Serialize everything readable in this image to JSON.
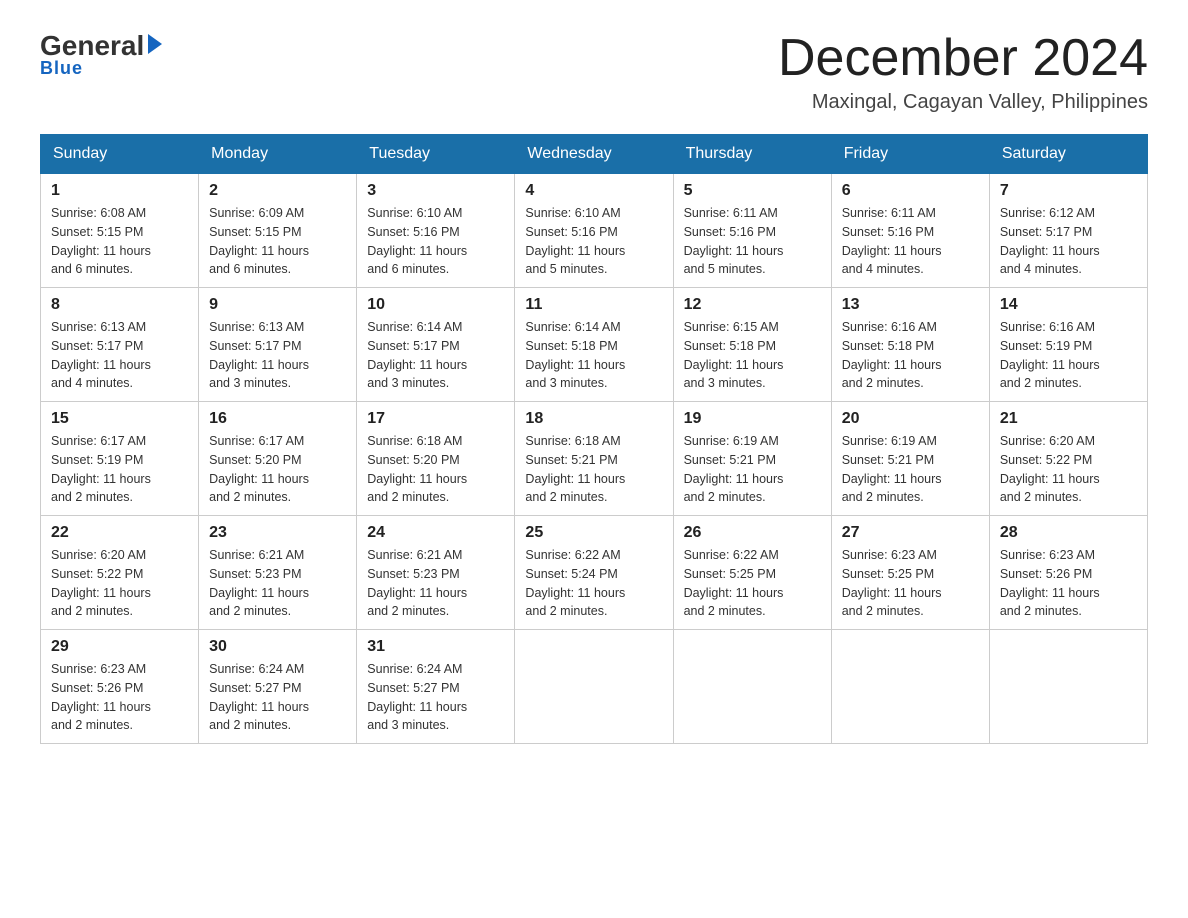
{
  "logo": {
    "general": "General",
    "arrow": "▶",
    "blue": "Blue"
  },
  "header": {
    "month_title": "December 2024",
    "location": "Maxingal, Cagayan Valley, Philippines"
  },
  "days_of_week": [
    "Sunday",
    "Monday",
    "Tuesday",
    "Wednesday",
    "Thursday",
    "Friday",
    "Saturday"
  ],
  "weeks": [
    [
      {
        "day": "1",
        "sunrise": "6:08 AM",
        "sunset": "5:15 PM",
        "daylight": "11 hours and 6 minutes."
      },
      {
        "day": "2",
        "sunrise": "6:09 AM",
        "sunset": "5:15 PM",
        "daylight": "11 hours and 6 minutes."
      },
      {
        "day": "3",
        "sunrise": "6:10 AM",
        "sunset": "5:16 PM",
        "daylight": "11 hours and 6 minutes."
      },
      {
        "day": "4",
        "sunrise": "6:10 AM",
        "sunset": "5:16 PM",
        "daylight": "11 hours and 5 minutes."
      },
      {
        "day": "5",
        "sunrise": "6:11 AM",
        "sunset": "5:16 PM",
        "daylight": "11 hours and 5 minutes."
      },
      {
        "day": "6",
        "sunrise": "6:11 AM",
        "sunset": "5:16 PM",
        "daylight": "11 hours and 4 minutes."
      },
      {
        "day": "7",
        "sunrise": "6:12 AM",
        "sunset": "5:17 PM",
        "daylight": "11 hours and 4 minutes."
      }
    ],
    [
      {
        "day": "8",
        "sunrise": "6:13 AM",
        "sunset": "5:17 PM",
        "daylight": "11 hours and 4 minutes."
      },
      {
        "day": "9",
        "sunrise": "6:13 AM",
        "sunset": "5:17 PM",
        "daylight": "11 hours and 3 minutes."
      },
      {
        "day": "10",
        "sunrise": "6:14 AM",
        "sunset": "5:17 PM",
        "daylight": "11 hours and 3 minutes."
      },
      {
        "day": "11",
        "sunrise": "6:14 AM",
        "sunset": "5:18 PM",
        "daylight": "11 hours and 3 minutes."
      },
      {
        "day": "12",
        "sunrise": "6:15 AM",
        "sunset": "5:18 PM",
        "daylight": "11 hours and 3 minutes."
      },
      {
        "day": "13",
        "sunrise": "6:16 AM",
        "sunset": "5:18 PM",
        "daylight": "11 hours and 2 minutes."
      },
      {
        "day": "14",
        "sunrise": "6:16 AM",
        "sunset": "5:19 PM",
        "daylight": "11 hours and 2 minutes."
      }
    ],
    [
      {
        "day": "15",
        "sunrise": "6:17 AM",
        "sunset": "5:19 PM",
        "daylight": "11 hours and 2 minutes."
      },
      {
        "day": "16",
        "sunrise": "6:17 AM",
        "sunset": "5:20 PM",
        "daylight": "11 hours and 2 minutes."
      },
      {
        "day": "17",
        "sunrise": "6:18 AM",
        "sunset": "5:20 PM",
        "daylight": "11 hours and 2 minutes."
      },
      {
        "day": "18",
        "sunrise": "6:18 AM",
        "sunset": "5:21 PM",
        "daylight": "11 hours and 2 minutes."
      },
      {
        "day": "19",
        "sunrise": "6:19 AM",
        "sunset": "5:21 PM",
        "daylight": "11 hours and 2 minutes."
      },
      {
        "day": "20",
        "sunrise": "6:19 AM",
        "sunset": "5:21 PM",
        "daylight": "11 hours and 2 minutes."
      },
      {
        "day": "21",
        "sunrise": "6:20 AM",
        "sunset": "5:22 PM",
        "daylight": "11 hours and 2 minutes."
      }
    ],
    [
      {
        "day": "22",
        "sunrise": "6:20 AM",
        "sunset": "5:22 PM",
        "daylight": "11 hours and 2 minutes."
      },
      {
        "day": "23",
        "sunrise": "6:21 AM",
        "sunset": "5:23 PM",
        "daylight": "11 hours and 2 minutes."
      },
      {
        "day": "24",
        "sunrise": "6:21 AM",
        "sunset": "5:23 PM",
        "daylight": "11 hours and 2 minutes."
      },
      {
        "day": "25",
        "sunrise": "6:22 AM",
        "sunset": "5:24 PM",
        "daylight": "11 hours and 2 minutes."
      },
      {
        "day": "26",
        "sunrise": "6:22 AM",
        "sunset": "5:25 PM",
        "daylight": "11 hours and 2 minutes."
      },
      {
        "day": "27",
        "sunrise": "6:23 AM",
        "sunset": "5:25 PM",
        "daylight": "11 hours and 2 minutes."
      },
      {
        "day": "28",
        "sunrise": "6:23 AM",
        "sunset": "5:26 PM",
        "daylight": "11 hours and 2 minutes."
      }
    ],
    [
      {
        "day": "29",
        "sunrise": "6:23 AM",
        "sunset": "5:26 PM",
        "daylight": "11 hours and 2 minutes."
      },
      {
        "day": "30",
        "sunrise": "6:24 AM",
        "sunset": "5:27 PM",
        "daylight": "11 hours and 2 minutes."
      },
      {
        "day": "31",
        "sunrise": "6:24 AM",
        "sunset": "5:27 PM",
        "daylight": "11 hours and 3 minutes."
      },
      null,
      null,
      null,
      null
    ]
  ],
  "labels": {
    "sunrise": "Sunrise:",
    "sunset": "Sunset:",
    "daylight": "Daylight:"
  }
}
